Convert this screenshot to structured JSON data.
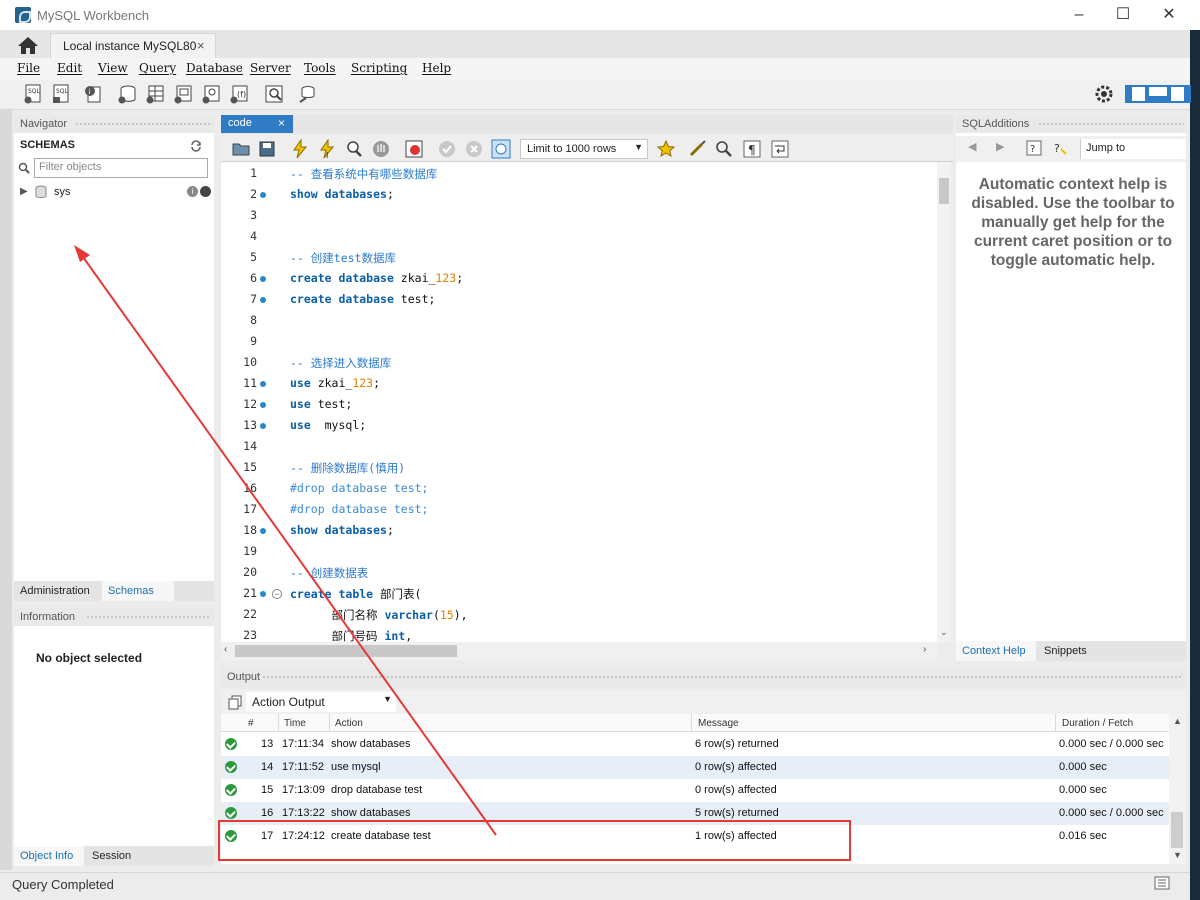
{
  "window": {
    "title": "MySQL Workbench",
    "connection_tab": "Local instance MySQL80",
    "close_glyph": "×"
  },
  "menu": [
    "File",
    "Edit",
    "View",
    "Query",
    "Database",
    "Server",
    "Tools",
    "Scripting",
    "Help"
  ],
  "navigator": {
    "header": "Navigator",
    "schemas_title": "SCHEMAS",
    "filter_placeholder": "Filter objects",
    "schemas": [
      "sys"
    ],
    "tabs": [
      "Administration",
      "Schemas"
    ],
    "active_tab": "Schemas"
  },
  "information": {
    "header": "Information",
    "message": "No object selected",
    "tabs": [
      "Object Info",
      "Session"
    ]
  },
  "editor": {
    "tab_label": "code",
    "limit_label": "Limit to 1000 rows",
    "lines": [
      {
        "n": "1",
        "dot": false,
        "text": "-- 查看系统中有哪些数据库",
        "kind": "comment"
      },
      {
        "n": "2",
        "dot": true,
        "text": "show databases;",
        "kind": "stmt"
      },
      {
        "n": "3",
        "dot": false,
        "text": "",
        "kind": "blank"
      },
      {
        "n": "4",
        "dot": false,
        "text": "",
        "kind": "blank"
      },
      {
        "n": "5",
        "dot": false,
        "text": "-- 创建test数据库",
        "kind": "comment"
      },
      {
        "n": "6",
        "dot": true,
        "text": "create database zkai_123;",
        "kind": "stmt"
      },
      {
        "n": "7",
        "dot": true,
        "text": "create database test;",
        "kind": "stmt"
      },
      {
        "n": "8",
        "dot": false,
        "text": "",
        "kind": "blank"
      },
      {
        "n": "9",
        "dot": false,
        "text": "",
        "kind": "blank"
      },
      {
        "n": "10",
        "dot": false,
        "text": "-- 选择进入数据库",
        "kind": "comment"
      },
      {
        "n": "11",
        "dot": true,
        "text": "use zkai_123;",
        "kind": "stmt"
      },
      {
        "n": "12",
        "dot": true,
        "text": "use test;",
        "kind": "stmt"
      },
      {
        "n": "13",
        "dot": true,
        "text": "use  mysql;",
        "kind": "stmt"
      },
      {
        "n": "14",
        "dot": false,
        "text": "",
        "kind": "blank"
      },
      {
        "n": "15",
        "dot": false,
        "text": "-- 删除数据库(慎用)",
        "kind": "comment"
      },
      {
        "n": "16",
        "dot": false,
        "text": "#drop database test;",
        "kind": "hash"
      },
      {
        "n": "17",
        "dot": false,
        "text": "#drop database test;",
        "kind": "hash"
      },
      {
        "n": "18",
        "dot": true,
        "text": "show databases;",
        "kind": "stmt"
      },
      {
        "n": "19",
        "dot": false,
        "text": "",
        "kind": "blank"
      },
      {
        "n": "20",
        "dot": false,
        "text": "-- 创建数据表",
        "kind": "comment"
      },
      {
        "n": "21",
        "dot": true,
        "fold": true,
        "text": "create table 部门表(",
        "kind": "stmt"
      },
      {
        "n": "22",
        "dot": false,
        "text": "      部门名称 varchar(15),",
        "kind": "stmt"
      },
      {
        "n": "23",
        "dot": false,
        "text": "      部门号码 int,",
        "kind": "stmt"
      }
    ],
    "keywords": [
      "show",
      "databases",
      "create",
      "database",
      "use",
      "table",
      "varchar",
      "int"
    ]
  },
  "sql_additions": {
    "header": "SQLAdditions",
    "jump_label": "Jump to",
    "help_lines": [
      "Automatic context help is",
      "disabled. Use the toolbar to",
      "manually get help for the",
      "current caret position or to",
      "toggle automatic help."
    ],
    "tabs": [
      "Context Help",
      "Snippets"
    ],
    "active_tab": "Context Help"
  },
  "output": {
    "header": "Output",
    "selector": "Action Output",
    "columns": [
      "#",
      "Time",
      "Action",
      "Message",
      "Duration / Fetch"
    ],
    "rows": [
      {
        "num": "13",
        "time": "17:11:34",
        "action": "show databases",
        "message": "6 row(s) returned",
        "duration": "0.000 sec / 0.000 sec"
      },
      {
        "num": "14",
        "time": "17:11:52",
        "action": "use mysql",
        "message": "0 row(s) affected",
        "duration": "0.000 sec"
      },
      {
        "num": "15",
        "time": "17:13:09",
        "action": "drop database test",
        "message": "0 row(s) affected",
        "duration": "0.000 sec"
      },
      {
        "num": "16",
        "time": "17:13:22",
        "action": "show databases",
        "message": "5 row(s) returned",
        "duration": "0.000 sec / 0.000 sec"
      },
      {
        "num": "17",
        "time": "17:24:12",
        "action": "create database test",
        "message": "1 row(s) affected",
        "duration": "0.016 sec"
      }
    ]
  },
  "status": {
    "text": "Query Completed"
  },
  "annotation": {
    "color": "#e53935"
  },
  "colors": {
    "accent": "#2f7cc4",
    "keyword": "#0b5ea8",
    "comment": "#2b7bd0",
    "number": "#e08000",
    "success": "#2a9a3a"
  }
}
